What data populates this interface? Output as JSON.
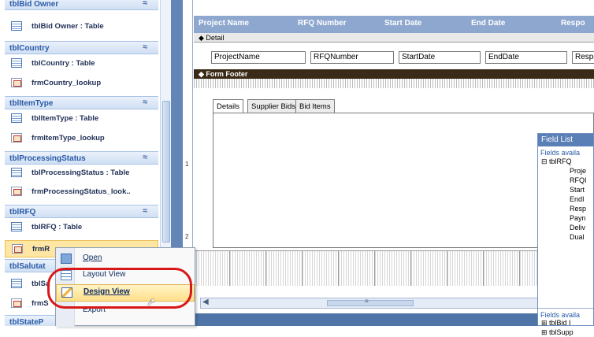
{
  "nav": {
    "groups": [
      {
        "label": "tblBid Owner",
        "items": [
          {
            "label": "tblBid Owner : Table",
            "kind": "table"
          }
        ]
      },
      {
        "label": "tblCountry",
        "items": [
          {
            "label": "tblCountry : Table",
            "kind": "table"
          },
          {
            "label": "frmCountry_lookup",
            "kind": "form"
          }
        ]
      },
      {
        "label": "tblItemType",
        "items": [
          {
            "label": "tblItemType : Table",
            "kind": "table"
          },
          {
            "label": "frmItemType_lookup",
            "kind": "form"
          }
        ]
      },
      {
        "label": "tblProcessingStatus",
        "items": [
          {
            "label": "tblProcessingStatus : Table",
            "kind": "table"
          },
          {
            "label": "frmProcessingStatus_look..",
            "kind": "form"
          }
        ]
      },
      {
        "label": "tblRFQ",
        "items": [
          {
            "label": "tblRFQ : Table",
            "kind": "table"
          },
          {
            "label": "frmR",
            "kind": "form"
          }
        ]
      },
      {
        "label": "tblSalutat",
        "items": [
          {
            "label": "tblSa",
            "kind": "table"
          },
          {
            "label": "frmS",
            "kind": "form"
          }
        ]
      },
      {
        "label": "tblStateP",
        "items": []
      }
    ],
    "chevron": "≈"
  },
  "design": {
    "headers": [
      "Project Name",
      "RFQ Number",
      "Start Date",
      "End Date",
      "Respo"
    ],
    "detail_label": "Detail",
    "footer_label": "Form Footer",
    "fields": [
      "ProjectName",
      "RFQNumber",
      "StartDate",
      "EndDate",
      "Respor"
    ],
    "tabs": [
      "Details",
      "Supplier Bids",
      "Bid Items"
    ],
    "ruler": [
      "1",
      "2"
    ]
  },
  "field_list": {
    "title": "Field List",
    "caption1": "Fields availa",
    "table": "tblRFQ",
    "fields": [
      "Proje",
      "RFQI",
      "Start",
      "EndI",
      "Resp",
      "Payn",
      "Deliv",
      "Dual"
    ],
    "caption2": "Fields availa",
    "tables2": [
      "tblBid I",
      "tblSupp"
    ]
  },
  "context_menu": {
    "items": [
      {
        "label": "Open",
        "icon": "open-form-icon"
      },
      {
        "label": "Layout View",
        "icon": "layout-view-icon"
      },
      {
        "label": "Design View",
        "icon": "design-view-icon",
        "highlight": true
      },
      {
        "label": "Export",
        "icon": ""
      }
    ],
    "highlight_color": "#ffe08a",
    "annotation_color": "#d81818"
  }
}
